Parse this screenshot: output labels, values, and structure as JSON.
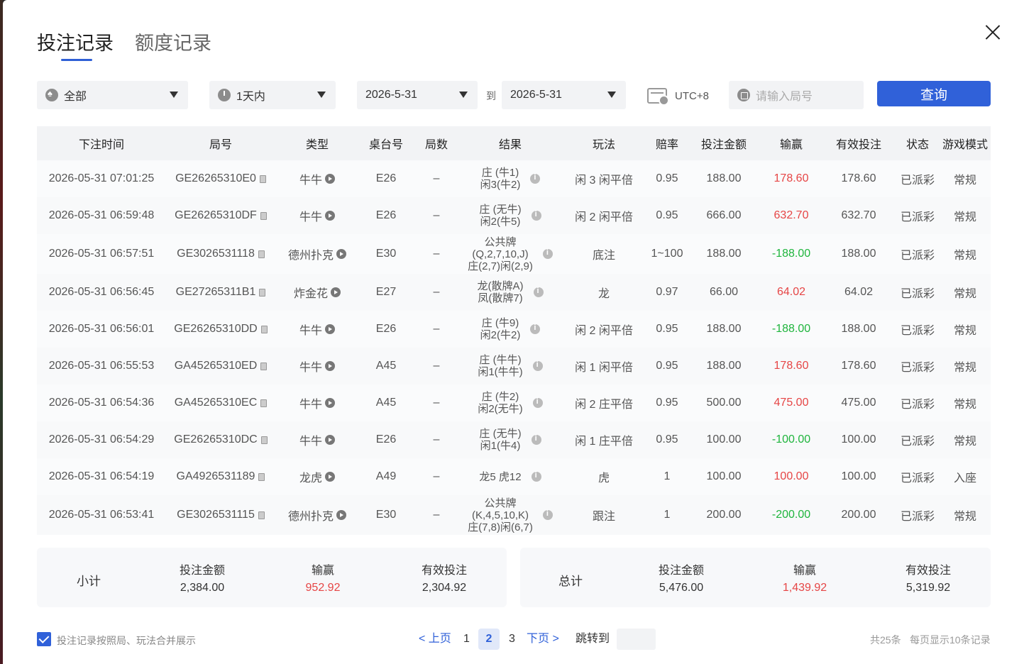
{
  "tabs": [
    {
      "label": "投注记录"
    },
    {
      "label": "额度记录"
    }
  ],
  "filters": {
    "game": "全部",
    "period": "1天内",
    "date_from": "2026-5-31",
    "to_label": "到",
    "date_to": "2026-5-31",
    "timezone": "UTC+8",
    "round_placeholder": "请输入局号",
    "query_label": "查询"
  },
  "table": {
    "headers": [
      "下注时间",
      "局号",
      "类型",
      "桌台号",
      "局数",
      "结果",
      "玩法",
      "赔率",
      "投注金额",
      "输赢",
      "有效投注",
      "状态",
      "游戏模式"
    ],
    "rows": [
      {
        "time": "2026-05-31 07:01:25",
        "round": "GE26265310E0",
        "type": "牛牛",
        "table": "E26",
        "num": "–",
        "result": [
          "庄 (牛1)",
          "闲3(牛2)"
        ],
        "play": "闲 3 闲平倍",
        "odds": "0.95",
        "amount": "188.00",
        "win": "178.60",
        "win_color": "red",
        "valid": "178.60",
        "status": "已派彩",
        "mode": "常规"
      },
      {
        "time": "2026-05-31 06:59:48",
        "round": "GE26265310DF",
        "type": "牛牛",
        "table": "E26",
        "num": "–",
        "result": [
          "庄 (无牛)",
          "闲2(牛5)"
        ],
        "play": "闲 2 闲平倍",
        "odds": "0.95",
        "amount": "666.00",
        "win": "632.70",
        "win_color": "red",
        "valid": "632.70",
        "status": "已派彩",
        "mode": "常规"
      },
      {
        "time": "2026-05-31 06:57:51",
        "round": "GE3026531118",
        "type": "德州扑克",
        "table": "E30",
        "num": "–",
        "result": [
          "公共牌",
          "(Q,2,7,10,J)",
          "庄(2,7)闲(2,9)"
        ],
        "play": "底注",
        "odds": "1~100",
        "amount": "188.00",
        "win": "-188.00",
        "win_color": "green",
        "valid": "188.00",
        "status": "已派彩",
        "mode": "常规"
      },
      {
        "time": "2026-05-31 06:56:45",
        "round": "GE27265311B1",
        "type": "炸金花",
        "table": "E27",
        "num": "–",
        "result": [
          "龙(散牌A)",
          "凤(散牌7)"
        ],
        "play": "龙",
        "odds": "0.97",
        "amount": "66.00",
        "win": "64.02",
        "win_color": "red",
        "valid": "64.02",
        "status": "已派彩",
        "mode": "常规"
      },
      {
        "time": "2026-05-31 06:56:01",
        "round": "GE26265310DD",
        "type": "牛牛",
        "table": "E26",
        "num": "–",
        "result": [
          "庄 (牛9)",
          "闲2(牛2)"
        ],
        "play": "闲 2 闲平倍",
        "odds": "0.95",
        "amount": "188.00",
        "win": "-188.00",
        "win_color": "green",
        "valid": "188.00",
        "status": "已派彩",
        "mode": "常规"
      },
      {
        "time": "2026-05-31 06:55:53",
        "round": "GA45265310ED",
        "type": "牛牛",
        "table": "A45",
        "num": "–",
        "result": [
          "庄 (牛牛)",
          "闲1(牛牛)"
        ],
        "play": "闲 1 闲平倍",
        "odds": "0.95",
        "amount": "188.00",
        "win": "178.60",
        "win_color": "red",
        "valid": "178.60",
        "status": "已派彩",
        "mode": "常规"
      },
      {
        "time": "2026-05-31 06:54:36",
        "round": "GA45265310EC",
        "type": "牛牛",
        "table": "A45",
        "num": "–",
        "result": [
          "庄 (牛2)",
          "闲2(无牛)"
        ],
        "play": "闲 2 庄平倍",
        "odds": "0.95",
        "amount": "500.00",
        "win": "475.00",
        "win_color": "red",
        "valid": "475.00",
        "status": "已派彩",
        "mode": "常规"
      },
      {
        "time": "2026-05-31 06:54:29",
        "round": "GE26265310DC",
        "type": "牛牛",
        "table": "E26",
        "num": "–",
        "result": [
          "庄 (无牛)",
          "闲1(牛4)"
        ],
        "play": "闲 1 庄平倍",
        "odds": "0.95",
        "amount": "100.00",
        "win": "-100.00",
        "win_color": "green",
        "valid": "100.00",
        "status": "已派彩",
        "mode": "常规"
      },
      {
        "time": "2026-05-31 06:54:19",
        "round": "GA4926531189",
        "type": "龙虎",
        "table": "A49",
        "num": "–",
        "result": [
          "龙5 虎12"
        ],
        "play": "虎",
        "odds": "1",
        "amount": "100.00",
        "win": "100.00",
        "win_color": "red",
        "valid": "100.00",
        "status": "已派彩",
        "mode": "入座"
      },
      {
        "time": "2026-05-31 06:53:41",
        "round": "GE3026531115",
        "type": "德州扑克",
        "table": "E30",
        "num": "–",
        "result": [
          "公共牌",
          "(K,4,5,10,K)",
          "庄(7,8)闲(6,7)"
        ],
        "play": "跟注",
        "odds": "1",
        "amount": "200.00",
        "win": "-200.00",
        "win_color": "green",
        "valid": "200.00",
        "status": "已派彩",
        "mode": "常规"
      }
    ]
  },
  "subtotal": {
    "label": "小计",
    "amount_label": "投注金额",
    "amount": "2,384.00",
    "win_label": "输赢",
    "win": "952.92",
    "valid_label": "有效投注",
    "valid": "2,304.92"
  },
  "total": {
    "label": "总计",
    "amount_label": "投注金额",
    "amount": "5,476.00",
    "win_label": "输赢",
    "win": "1,439.92",
    "valid_label": "有效投注",
    "valid": "5,319.92"
  },
  "footer": {
    "merge_label": "投注记录按照局、玩法合并展示",
    "prev": "< 上页",
    "pages": [
      "1",
      "2",
      "3"
    ],
    "current_page": "2",
    "next": "下页 >",
    "jump_label": "跳转到",
    "total_count": "共25条",
    "per_page": "每页显示10条记录"
  },
  "colors": {
    "accent": "#3061d9",
    "win": "#e64545",
    "loss": "#1fb53d"
  }
}
